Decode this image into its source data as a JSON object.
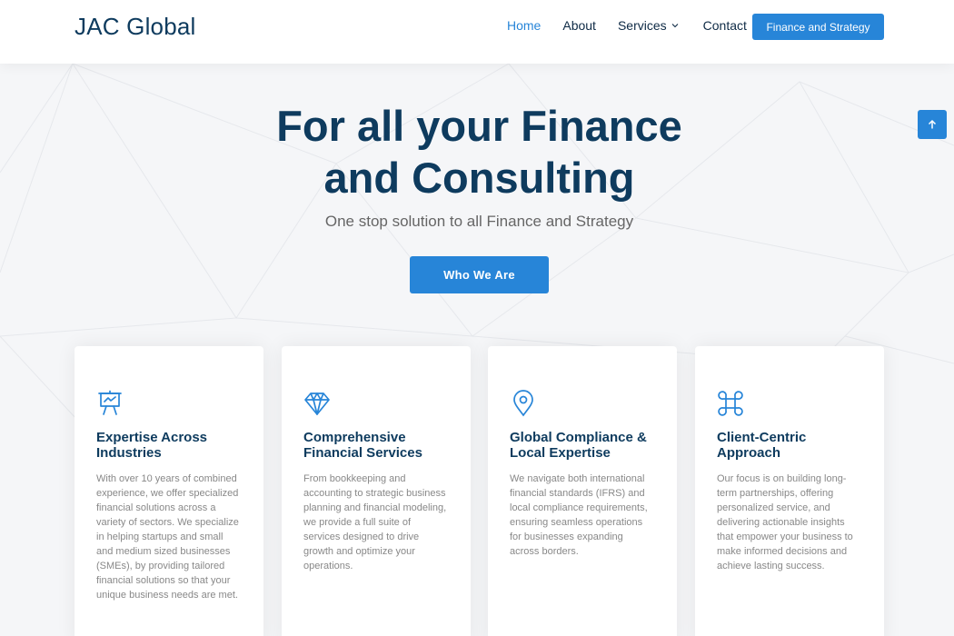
{
  "header": {
    "logo": "JAC Global",
    "nav": [
      {
        "label": "Home",
        "active": true
      },
      {
        "label": "About",
        "active": false
      },
      {
        "label": "Services",
        "active": false
      },
      {
        "label": "Contact",
        "active": false
      }
    ],
    "cta_label": "Finance and Strategy"
  },
  "hero": {
    "title_line1": "For all your Finance",
    "title_line2": "and Consulting",
    "subtitle": "One stop solution to all Finance and Strategy",
    "button_label": "Who We Are"
  },
  "cards": [
    {
      "icon": "presentation-easel-icon",
      "title_line1": "Expertise Across",
      "title_line2": "Industries",
      "text": "With over 10 years of combined experience, we offer specialized financial solutions across a variety of sectors. We specialize in helping startups and small and medium sized businesses (SMEs), by providing tailored financial solutions so that your unique business needs are met."
    },
    {
      "icon": "diamond-icon",
      "title_line1": "Comprehensive",
      "title_line2": "Financial Services",
      "text": "From bookkeeping and accounting to strategic business planning and financial modeling, we provide a full suite of services designed to drive growth and optimize your operations."
    },
    {
      "icon": "map-pin-icon",
      "title_line1": "Global Compliance &",
      "title_line2": "Local Expertise",
      "text": "We navigate both international financial standards (IFRS) and local compliance requirements, ensuring seamless operations for businesses expanding across borders."
    },
    {
      "icon": "command-icon",
      "title_line1": "Client-Centric",
      "title_line2": "Approach",
      "text": "Our focus is on building long-term partnerships, offering personalized service, and delivering actionable insights that empower your business to make informed decisions and achieve lasting success."
    }
  ],
  "colors": {
    "accent": "#2785d8",
    "heading": "#0e3b5e",
    "body_text": "#888888",
    "page_bg": "#f5f6f8"
  },
  "icons": {
    "scroll_top": "arrow-up-icon",
    "services_dropdown": "chevron-down-icon"
  }
}
